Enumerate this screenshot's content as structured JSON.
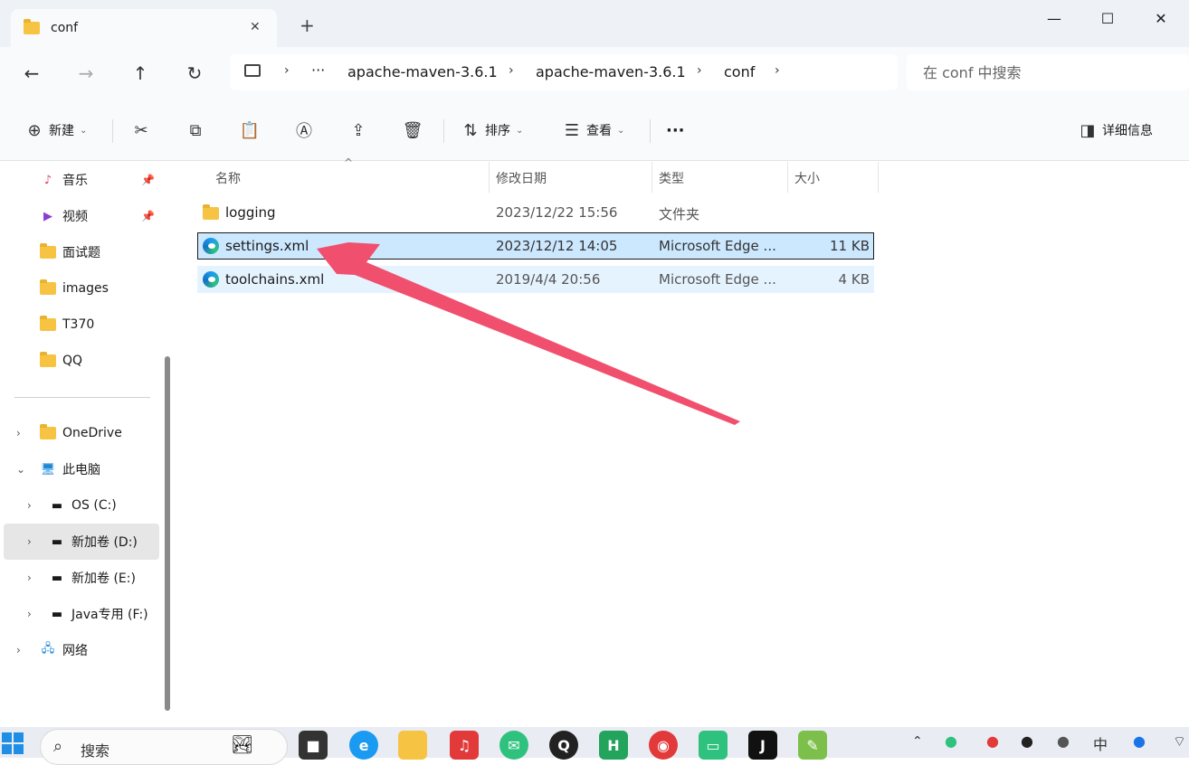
{
  "window": {
    "tab_title": "conf",
    "close_tab": "✕",
    "new_tab": "+",
    "minimize": "—",
    "maximize": "☐",
    "close": "✕"
  },
  "nav": {
    "back": "←",
    "forward": "→",
    "up": "↑",
    "refresh": "↻"
  },
  "breadcrumb": {
    "overflow": "···",
    "items": [
      "apache-maven-3.6.1",
      "apache-maven-3.6.1",
      "conf"
    ]
  },
  "search": {
    "placeholder": "在 conf 中搜索"
  },
  "toolbar": {
    "new_label": "新建",
    "sort_label": "排序",
    "view_label": "查看",
    "more_label": "···",
    "details_label": "详细信息"
  },
  "sidebar": {
    "quick_access": [
      {
        "label": "音乐",
        "icon": "music-icon",
        "pinned": true
      },
      {
        "label": "视频",
        "icon": "video-icon",
        "pinned": true
      },
      {
        "label": "面试题",
        "icon": "folder-icon",
        "pinned": false
      },
      {
        "label": "images",
        "icon": "folder-icon",
        "pinned": false
      },
      {
        "label": "T370",
        "icon": "folder-icon",
        "pinned": false
      },
      {
        "label": "QQ",
        "icon": "folder-icon",
        "pinned": false
      }
    ],
    "tree": [
      {
        "label": "OneDrive",
        "icon": "folder-icon"
      },
      {
        "label": "此电脑",
        "icon": "computer-icon"
      },
      {
        "label": "OS (C:)",
        "icon": "drive-icon"
      },
      {
        "label": "新加卷 (D:)",
        "icon": "drive-icon"
      },
      {
        "label": "新加卷 (E:)",
        "icon": "drive-icon"
      },
      {
        "label": "Java专用 (F:)",
        "icon": "drive-icon"
      },
      {
        "label": "网络",
        "icon": "network-icon"
      }
    ]
  },
  "columns": {
    "name": "名称",
    "modified": "修改日期",
    "type": "类型",
    "size": "大小"
  },
  "files": [
    {
      "name": "logging",
      "modified": "2023/12/22 15:56",
      "type": "文件夹",
      "size": ""
    },
    {
      "name": "settings.xml",
      "modified": "2023/12/12 14:05",
      "type": "Microsoft Edge ...",
      "size": "11 KB"
    },
    {
      "name": "toolchains.xml",
      "modified": "2019/4/4 20:56",
      "type": "Microsoft Edge ...",
      "size": "4 KB"
    }
  ],
  "taskbar": {
    "search_label": "搜索"
  },
  "colors": {
    "selected_row": "#cce8ff",
    "hover_row": "#e5f3ff",
    "arrow": "#f0506e"
  }
}
